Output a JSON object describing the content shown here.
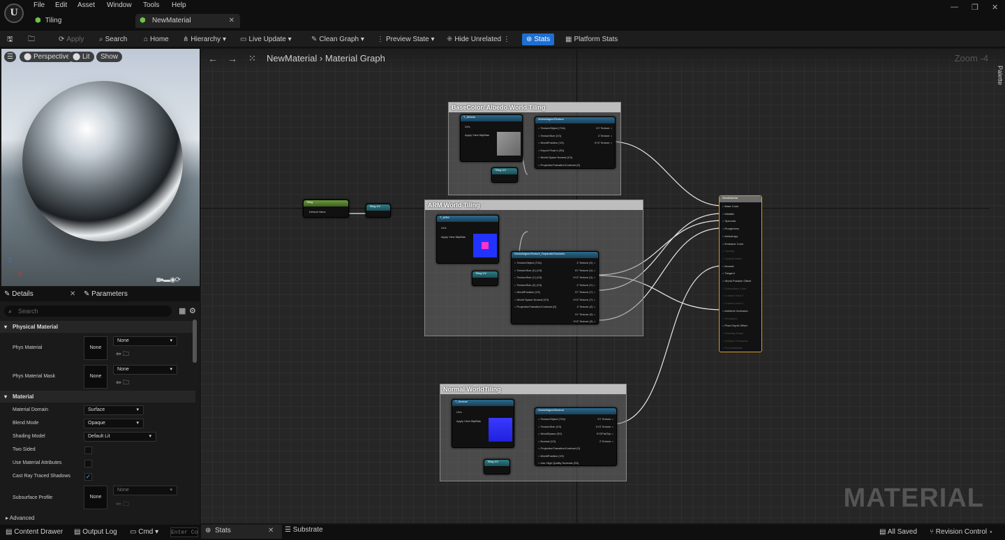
{
  "menu": {
    "items": [
      "File",
      "Edit",
      "Asset",
      "Window",
      "Tools",
      "Help"
    ],
    "logo": "U"
  },
  "tabs": [
    {
      "label": "Tiling"
    },
    {
      "label": "NewMaterial"
    }
  ],
  "toolbar": {
    "apply": "Apply",
    "search": "Search",
    "home": "Home",
    "hierarchy": "Hierarchy",
    "live_update": "Live Update",
    "clean_graph": "Clean Graph",
    "preview_state": "Preview State",
    "hide_unrelated": "Hide Unrelated",
    "stats": "Stats",
    "platform_stats": "Platform Stats"
  },
  "viewport": {
    "perspective": "Perspective",
    "lit": "Lit",
    "show": "Show",
    "axis_z": "Z",
    "axis_x": "X"
  },
  "details": {
    "tab_details": "Details",
    "tab_parameters": "Parameters",
    "search_placeholder": "Search",
    "physical_section": "Physical Material",
    "phys_material": "Phys Material",
    "phys_material_value": "None",
    "phys_material_thumb": "None",
    "phys_material_mask": "Phys Material Mask",
    "phys_mask_value": "None",
    "phys_mask_thumb": "None",
    "material_section": "Material",
    "material_domain": "Material Domain",
    "material_domain_value": "Surface",
    "blend_mode": "Blend Mode",
    "blend_mode_value": "Opaque",
    "shading_model": "Shading Model",
    "shading_model_value": "Default Lit",
    "two_sided": "Two Sided",
    "use_attrs": "Use Material Attributes",
    "cast_ray": "Cast Ray Traced Shadows",
    "subsurface": "Subsurface Profile",
    "subsurface_value": "None",
    "subsurface_thumb": "None",
    "advanced": "Advanced"
  },
  "graph": {
    "breadcrumb_root": "NewMaterial",
    "breadcrumb_sep": "›",
    "breadcrumb_page": "Material Graph",
    "zoom": "Zoom -4",
    "palette": "Palette",
    "watermark": "MATERIAL",
    "comments": {
      "base": "BaseColor/ Albedo World Tiling",
      "arm": "ARM World Tiling",
      "normal": "Normal WorldTiling"
    },
    "nodes": {
      "albedo_title": "T_Albedo",
      "param_sub": "Param Tex Object",
      "uvs": "UVs",
      "mip": "Apply View MipBias",
      "wat_title": "WorldAlignedTexture",
      "wat_pins": [
        "TextureObject (T2d)",
        "TextureSize (V3)",
        "WorldPosition (V3)",
        "Export Float 4 (S0)",
        "World Space Normal (V3)",
        "ProjectionTransitionContrast (S)"
      ],
      "wat_out": [
        "XY Texture",
        "Z Texture",
        "XYZ Texture"
      ],
      "tiling_uv": "Tiling UV",
      "tiling_param": "Tiling",
      "default_value": "Default Value",
      "arm_title": "T_ARM",
      "sep_title": "WorldAlignedTexture_SeparateChannels",
      "sep_pins": [
        "TextureObject (T2d)",
        "TextureSize (X) (V3)",
        "TextureSize (Y) (V3)",
        "TextureSize (Z) (V3)",
        "WorldPosition (V3)",
        "World Space Normal (V3)",
        "ProjectionTransitionContrast (S)"
      ],
      "sep_out": [
        "Z Texture (X)",
        "XY Texture (X)",
        "XYZ Texture (X)",
        "Z Texture (Y)",
        "XY Texture (Y)",
        "XYZ Texture (Y)",
        "Z Texture (Z)",
        "XY Texture (Z)",
        "XYZ Texture (Z)"
      ],
      "normal_title": "T_Normal",
      "wan_title": "WorldAlignedNormal",
      "wan_pins": [
        "TextureObject (T2d)",
        "TextureSize (V3)",
        "WorldSpace (S0)",
        "Normal (V3)",
        "ProjectionTransitionContrast (S)",
        "WorldPosition (V3)",
        "Use High Quality Normals (S0)"
      ],
      "wan_out": [
        "XY Texture",
        "XYZ Texture",
        "XYZFlatTop",
        "Z Texture"
      ],
      "result_title": "NewMaterial",
      "result_pins": [
        "Base Color",
        "Metallic",
        "Specular",
        "Roughness",
        "Anisotropy",
        "Emissive Color",
        "Opacity",
        "Opacity Mask",
        "Normal",
        "Tangent",
        "World Position Offset",
        "Subsurface Color",
        "Custom Data 0",
        "Custom Data 1",
        "Ambient Occlusion",
        "Refraction",
        "Pixel Depth Offset",
        "Shading Model",
        "Surface Thickness",
        "Front Material"
      ]
    }
  },
  "bottom": {
    "content_drawer": "Content Drawer",
    "output_log": "Output Log",
    "cmd": "Cmd",
    "console_placeholder": "Enter Console Command",
    "stats": "Stats",
    "substrate": "Substrate",
    "all_saved": "All Saved",
    "revision": "Revision Control"
  }
}
